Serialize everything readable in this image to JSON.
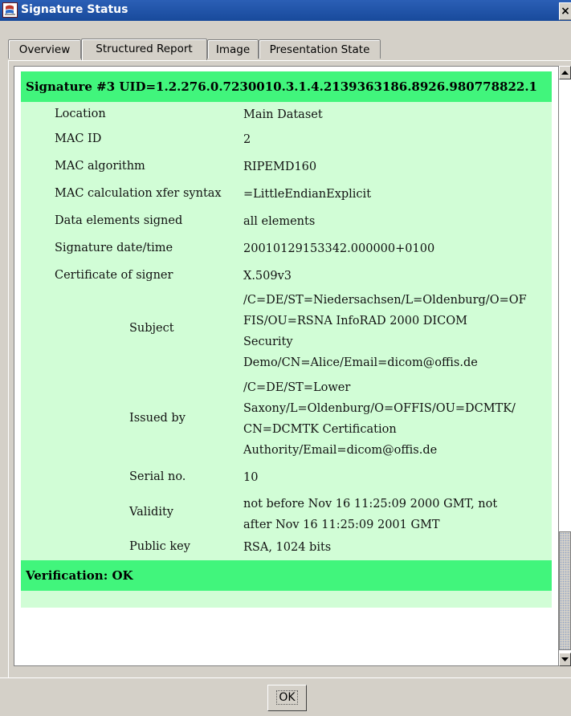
{
  "window": {
    "title": "Signature Status",
    "close_glyph": "×"
  },
  "tabs": [
    {
      "label": "Overview"
    },
    {
      "label": "Structured Report"
    },
    {
      "label": "Image"
    },
    {
      "label": "Presentation State"
    }
  ],
  "active_tab": "Structured Report",
  "signature": {
    "header": "Signature #3 UID=1.2.276.0.7230010.3.1.4.2139363186.8926.980778822.1",
    "rows": [
      {
        "label": "Location",
        "value": "Main Dataset"
      },
      {
        "label": "MAC ID",
        "value": "2"
      },
      {
        "label": "MAC algorithm",
        "value": "RIPEMD160"
      },
      {
        "label": "MAC calculation xfer syntax",
        "value": "=LittleEndianExplicit"
      },
      {
        "label": "Data elements signed",
        "value": "all elements"
      },
      {
        "label": "Signature date/time",
        "value": "20010129153342.000000+0100"
      },
      {
        "label": "Certificate of signer",
        "value": "X.509v3"
      }
    ],
    "certificate": [
      {
        "label": "Subject",
        "lines": [
          "/C=DE/ST=Niedersachsen/L=Oldenburg/O=OF",
          "FIS/OU=RSNA InfoRAD 2000 DICOM",
          "Security",
          "Demo/CN=Alice/Email=dicom@offis.de"
        ]
      },
      {
        "label": "Issued by",
        "lines": [
          "/C=DE/ST=Lower",
          "Saxony/L=Oldenburg/O=OFFIS/OU=DCMTK/",
          "CN=DCMTK Certification",
          "Authority/Email=dicom@offis.de"
        ]
      },
      {
        "label": "Serial no.",
        "lines": [
          "10"
        ]
      },
      {
        "label": "Validity",
        "lines": [
          "not before Nov 16 11:25:09 2000 GMT, not",
          "after Nov 16 11:25:09 2001 GMT"
        ]
      },
      {
        "label": "Public key",
        "lines": [
          "RSA, 1024 bits"
        ]
      }
    ],
    "verification": "Verification: OK"
  },
  "buttons": {
    "ok": "OK"
  },
  "colors": {
    "status_green": "#41f57c",
    "panel_green": "#d1fdd6",
    "title_blue": "#1f51a8"
  }
}
